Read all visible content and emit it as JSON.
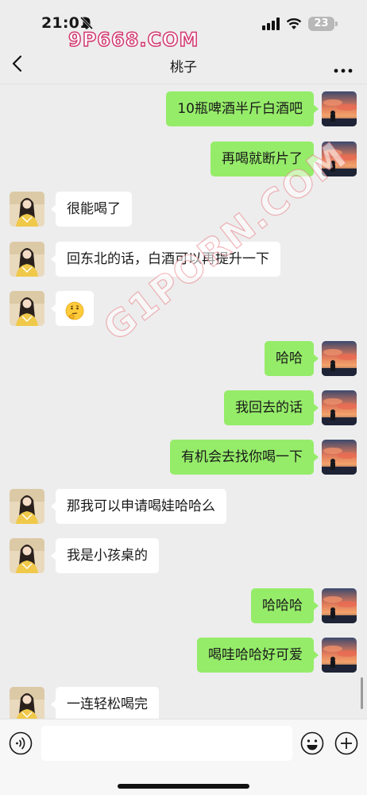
{
  "status_bar": {
    "time": "21:01",
    "battery": "23",
    "watermark": "9P668.COM",
    "icons": [
      "bell-slash-icon",
      "signal-icon",
      "wifi-icon",
      "battery-icon"
    ]
  },
  "nav": {
    "title": "桃子",
    "back_icon": "chevron-left-icon",
    "more_icon": "more-dots-icon"
  },
  "overlay": {
    "diagonal_watermark": "G1PORN.COM"
  },
  "messages": [
    {
      "side": "right",
      "text": "10瓶啤酒半斤白酒吧"
    },
    {
      "side": "right",
      "text": "再喝就断片了"
    },
    {
      "side": "left",
      "text": "很能喝了"
    },
    {
      "side": "left",
      "text": "回东北的话，白酒可以再提升一下"
    },
    {
      "side": "left",
      "text": "",
      "emoji": "thinking-face-emoji"
    },
    {
      "side": "right",
      "text": "哈哈"
    },
    {
      "side": "right",
      "text": "我回去的话"
    },
    {
      "side": "right",
      "text": "有机会去找你喝一下"
    },
    {
      "side": "left",
      "text": "那我可以申请喝娃哈哈么"
    },
    {
      "side": "left",
      "text": "我是小孩桌的"
    },
    {
      "side": "right",
      "text": "哈哈哈"
    },
    {
      "side": "right",
      "text": "喝哇哈哈好可爱"
    },
    {
      "side": "left",
      "text": "一连轻松喝完"
    }
  ],
  "input_bar": {
    "value": "",
    "placeholder": "",
    "icons": [
      "voice-icon",
      "emoji-smile-icon",
      "plus-circle-icon"
    ]
  },
  "colors": {
    "background": "#ededed",
    "right_bubble": "#95ec69",
    "left_bubble": "#ffffff",
    "watermark_stroke": "#d2386f"
  }
}
